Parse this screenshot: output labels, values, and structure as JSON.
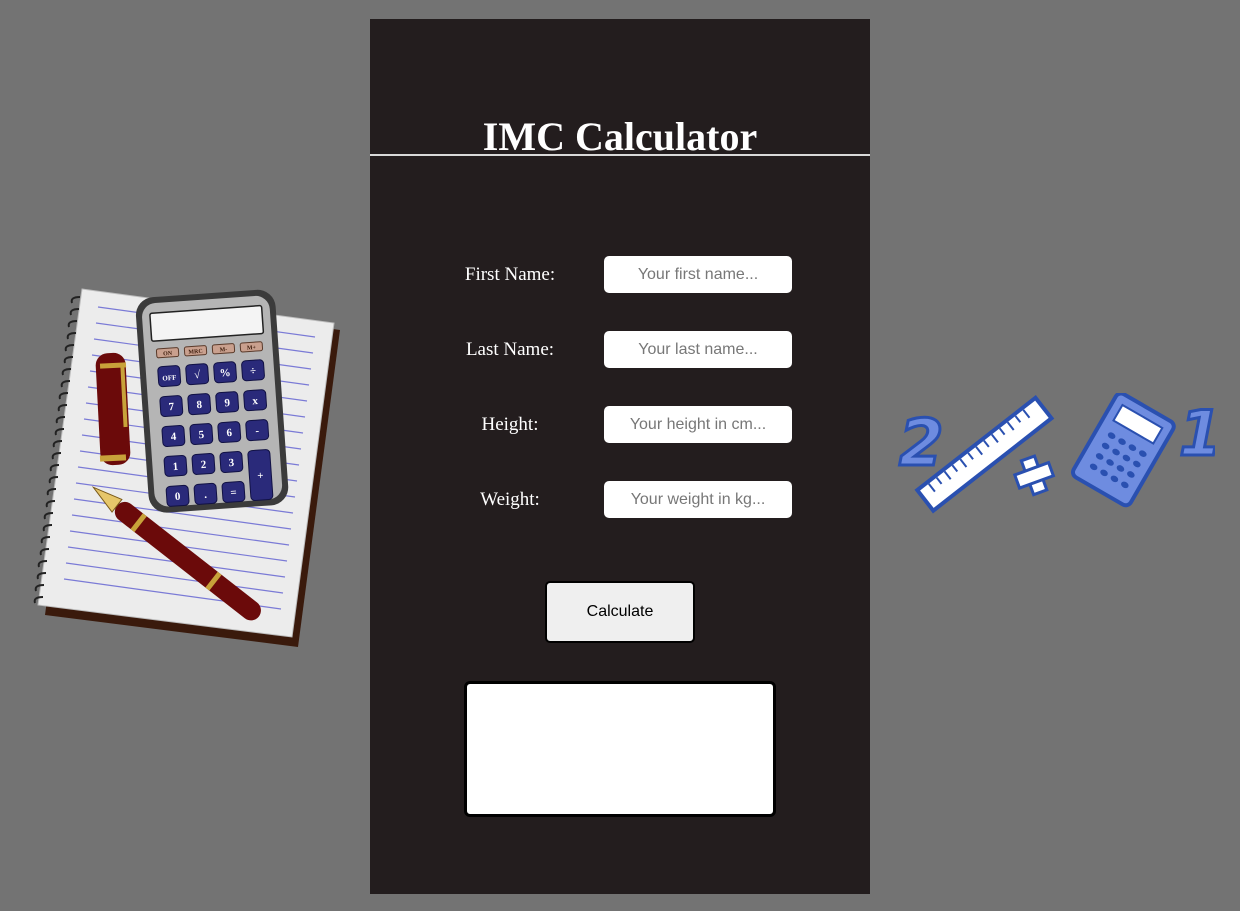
{
  "header": {
    "title": "IMC Calculator"
  },
  "form": {
    "first_name": {
      "label": "First Name:",
      "placeholder": "Your first name..."
    },
    "last_name": {
      "label": "Last Name:",
      "placeholder": "Your last name..."
    },
    "height": {
      "label": "Height:",
      "placeholder": "Your height in cm..."
    },
    "weight": {
      "label": "Weight:",
      "placeholder": "Your weight in kg..."
    }
  },
  "actions": {
    "calculate_label": "Calculate"
  },
  "decorations": {
    "left": "notebook-calculator-pen-icon",
    "right": "math-ruler-calculator-icon",
    "right_numbers": [
      "2",
      "1"
    ],
    "calculator_keys": [
      "ON",
      "MRC",
      "M-",
      "M+",
      "OFF",
      "√",
      "%",
      "÷",
      "7",
      "8",
      "9",
      "x",
      "4",
      "5",
      "6",
      "-",
      "1",
      "2",
      "3",
      "+",
      "0",
      ".",
      "="
    ]
  },
  "colors": {
    "page_background": "#737373",
    "panel_background": "#231d1e",
    "accent_blue": "#3a64c0"
  }
}
